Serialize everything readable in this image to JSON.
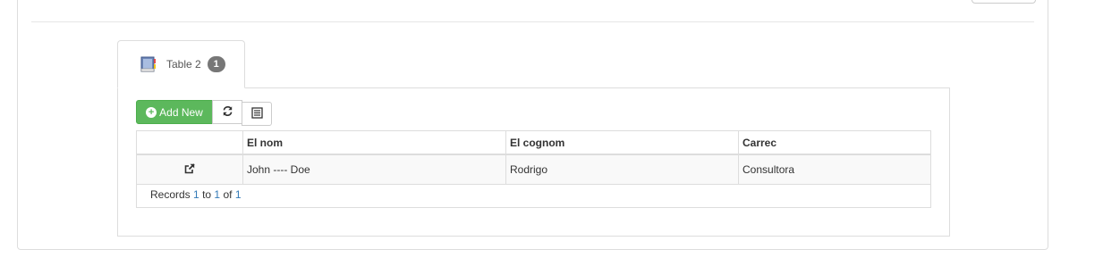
{
  "tab": {
    "label": "Table 2",
    "count": "1",
    "icon": "book-icon"
  },
  "toolbar": {
    "add_label": "Add New",
    "refresh_icon": "refresh-icon",
    "columns_icon": "list-icon"
  },
  "grid": {
    "columns": [
      "",
      "El nom",
      "El cognom",
      "Carrec"
    ],
    "rows": [
      {
        "action_icon": "external-link-icon",
        "cells": [
          "John ---- Doe",
          "Rodrigo",
          "Consultora"
        ]
      }
    ],
    "footer": {
      "prefix": "Records",
      "from": "1",
      "to_word": "to",
      "to": "1",
      "of_word": "of",
      "total": "1"
    }
  },
  "colors": {
    "add_button": "#5cb85c",
    "badge": "#777777",
    "link": "#337ab7"
  }
}
